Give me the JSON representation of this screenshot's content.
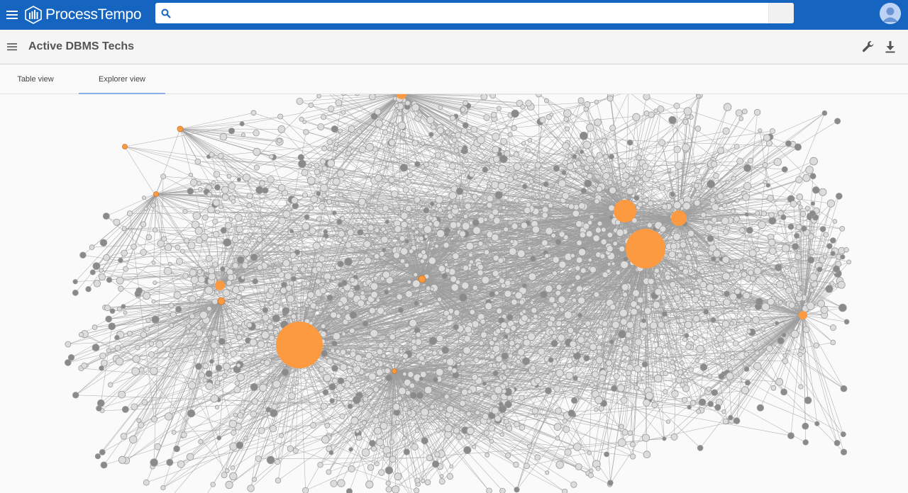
{
  "app": {
    "brand": "ProcessTempo"
  },
  "search": {
    "value": "",
    "placeholder": ""
  },
  "toolbar": {
    "title": "Active DBMS Techs"
  },
  "tabs": [
    {
      "label": "Table view",
      "active": false
    },
    {
      "label": "Explorer view",
      "active": true
    }
  ],
  "colors": {
    "header": "#1565c0",
    "hub": "#fb9a40",
    "node": "#dcdcdc",
    "edge": "#9e9e9e"
  },
  "icons": {
    "menu": "hamburger-icon",
    "search": "search-icon",
    "wrench": "wrench-icon",
    "download": "download-icon",
    "avatar": "user-avatar-icon"
  }
}
